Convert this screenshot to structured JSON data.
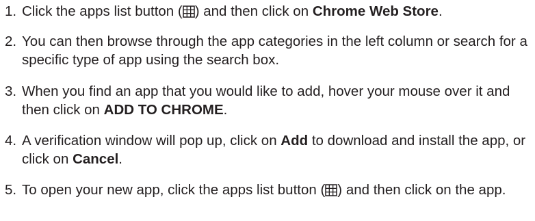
{
  "steps": [
    {
      "number": "1.",
      "segments": [
        {
          "t": "text",
          "v": "Click the apps list button ("
        },
        {
          "t": "icon",
          "name": "apps-grid-icon"
        },
        {
          "t": "text",
          "v": ") and then click on "
        },
        {
          "t": "bold",
          "v": "Chrome Web Store"
        },
        {
          "t": "text",
          "v": "."
        }
      ]
    },
    {
      "number": "2.",
      "segments": [
        {
          "t": "text",
          "v": "You can then browse through the app categories in the left column or search for a specific type of app using the search box."
        }
      ]
    },
    {
      "number": "3.",
      "segments": [
        {
          "t": "text",
          "v": "When you find an app that you would like to add, hover your mouse over it and then click on "
        },
        {
          "t": "bold",
          "v": "ADD TO CHROME"
        },
        {
          "t": "text",
          "v": "."
        }
      ]
    },
    {
      "number": "4.",
      "segments": [
        {
          "t": "text",
          "v": "A verification window will pop up, click on "
        },
        {
          "t": "bold",
          "v": "Add"
        },
        {
          "t": "text",
          "v": " to download and install the app, or click on "
        },
        {
          "t": "bold",
          "v": "Cancel"
        },
        {
          "t": "text",
          "v": "."
        }
      ]
    },
    {
      "number": "5.",
      "segments": [
        {
          "t": "text",
          "v": "To open your new app, click the apps list button ("
        },
        {
          "t": "icon",
          "name": "apps-grid-icon"
        },
        {
          "t": "text",
          "v": ") and then click on the app."
        }
      ]
    }
  ]
}
